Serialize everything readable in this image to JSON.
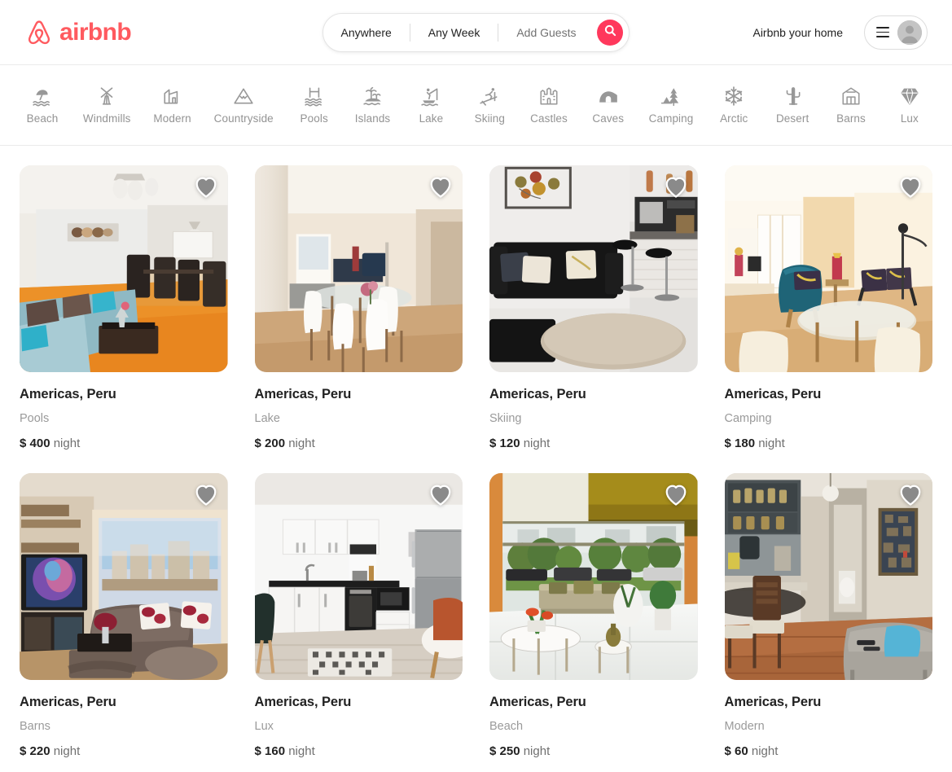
{
  "brand": {
    "name": "airbnb",
    "color": "#FF5A5F",
    "logo_icon": "airbnb-belo-logo"
  },
  "search": {
    "location_label": "Anywhere",
    "dates_label": "Any Week",
    "guests_label": "Add Guests",
    "search_icon": "search-icon",
    "button_color": "#FF385C"
  },
  "header": {
    "host_link": "Airbnb your home",
    "menu_icon": "hamburger-menu-icon",
    "avatar_icon": "user-avatar-icon"
  },
  "categories": [
    {
      "label": "Beach",
      "icon": "beach-umbrella-icon"
    },
    {
      "label": "Windmills",
      "icon": "windmill-icon"
    },
    {
      "label": "Modern",
      "icon": "modern-house-icon"
    },
    {
      "label": "Countryside",
      "icon": "mountain-icon"
    },
    {
      "label": "Pools",
      "icon": "pool-icon"
    },
    {
      "label": "Islands",
      "icon": "island-palm-icon"
    },
    {
      "label": "Lake",
      "icon": "fishing-lake-icon"
    },
    {
      "label": "Skiing",
      "icon": "skier-icon"
    },
    {
      "label": "Castles",
      "icon": "castle-icon"
    },
    {
      "label": "Caves",
      "icon": "cave-icon"
    },
    {
      "label": "Camping",
      "icon": "camping-tent-tree-icon"
    },
    {
      "label": "Arctic",
      "icon": "snowflake-icon"
    },
    {
      "label": "Desert",
      "icon": "cactus-icon"
    },
    {
      "label": "Barns",
      "icon": "barn-icon"
    },
    {
      "label": "Lux",
      "icon": "diamond-icon"
    }
  ],
  "listings": [
    {
      "title": "Americas, Peru",
      "category": "Pools",
      "currency": "$",
      "price": "400",
      "period": "night",
      "favorite_icon": "heart-icon",
      "photo": "living-room-blue-sofa-orange-floor"
    },
    {
      "title": "Americas, Peru",
      "category": "Lake",
      "currency": "$",
      "price": "200",
      "period": "night",
      "favorite_icon": "heart-icon",
      "photo": "dining-room-glass-table-white-chairs"
    },
    {
      "title": "Americas, Peru",
      "category": "Skiing",
      "currency": "$",
      "price": "120",
      "period": "night",
      "favorite_icon": "heart-icon",
      "photo": "living-room-black-sofa-kitchen-bar"
    },
    {
      "title": "Americas, Peru",
      "category": "Camping",
      "currency": "$",
      "price": "180",
      "period": "night",
      "favorite_icon": "heart-icon",
      "photo": "bright-living-room-teal-armchair"
    },
    {
      "title": "Americas, Peru",
      "category": "Barns",
      "currency": "$",
      "price": "220",
      "period": "night",
      "favorite_icon": "heart-icon",
      "photo": "living-room-tv-city-window-brown-sofa"
    },
    {
      "title": "Americas, Peru",
      "category": "Lux",
      "currency": "$",
      "price": "160",
      "period": "night",
      "favorite_icon": "heart-icon",
      "photo": "white-modern-kitchen-wood-floor"
    },
    {
      "title": "Americas, Peru",
      "category": "Beach",
      "currency": "$",
      "price": "250",
      "period": "night",
      "favorite_icon": "heart-icon",
      "photo": "lobby-lounge-garden-window-tile-floor"
    },
    {
      "title": "Americas, Peru",
      "category": "Modern",
      "currency": "$",
      "price": "60",
      "period": "night",
      "favorite_icon": "heart-icon",
      "photo": "dining-area-gray-sofa-blue-cushion"
    }
  ]
}
